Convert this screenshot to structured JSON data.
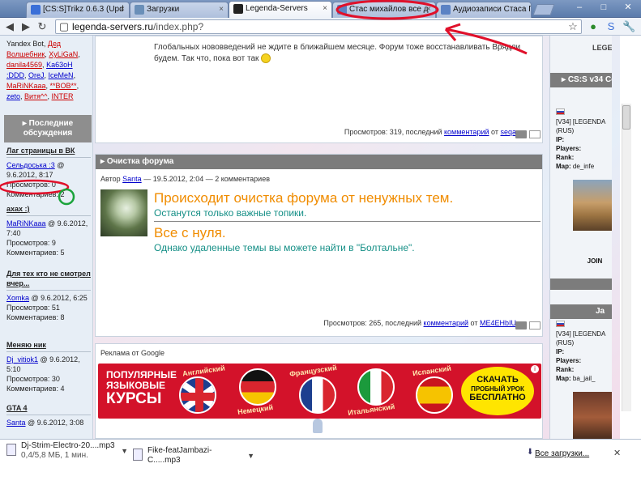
{
  "tabs": [
    {
      "label": "[CS:S]Trikz 0.6.3 (Upd",
      "color": "#3a6fd8"
    },
    {
      "label": "Загрузки",
      "color": "#6a8fb8"
    },
    {
      "label": "Legenda-Servers",
      "color": "#222222"
    },
    {
      "label": "Стас михайлов все д",
      "color": "#5b82c4"
    },
    {
      "label": "Аудиозаписи Стаса Г",
      "color": "#5b82c4"
    }
  ],
  "window_controls": {
    "minimize": "–",
    "maximize": "□",
    "close": "✕"
  },
  "omnibox": {
    "host": "legenda-servers.ru",
    "path": "/index.php?"
  },
  "sidebar": {
    "users_prefix": "Yandex Bot,",
    "users": [
      "Дед Волшебник",
      "XyLiGaN",
      "danila4569",
      "Ka63oH :DDD",
      "OreJ",
      "IceMeN",
      "MaRiNKaaa",
      "**BOB**",
      "zeto",
      "Витя^^",
      "INTER"
    ],
    "discussions_header": "Последние обсуждения",
    "discussions": [
      {
        "title": "Лаг страницы в ВК",
        "author": "Сельдоська :3",
        "date": "9.6.2012, 8:17",
        "views": "Просмотров: 0",
        "comments": "Комментариев: 2"
      },
      {
        "title": "ахах :)",
        "author": "MaRiNKaaa",
        "date": "9.6.2012, 7:40",
        "views": "Просмотров: 9",
        "comments": "Комментариев: 5"
      },
      {
        "title": "Для тех кто не смотрел вчер...",
        "author": "Xomka",
        "date": "9.6.2012, 6:25",
        "views": "Просмотров: 51",
        "comments": "Комментариев: 8"
      },
      {
        "title": "Меняю ник",
        "author": "Dj_vitiok1",
        "date": "9.6.2012, 5:10",
        "views": "Просмотров: 30",
        "comments": "Комментариев: 4"
      },
      {
        "title": "GTA 4",
        "author": "Santa",
        "date": "9.6.2012, 3:08",
        "views": "",
        "comments": ""
      }
    ]
  },
  "post_top": {
    "text": "Глобальных нововведений не ждите в ближайшем месяце. Форум тоже восстанавливать Врядли будем. Так что, пока вот так",
    "meta_prefix": "Просмотров: 319, последний",
    "meta_link": "комментарий",
    "meta_by": "от",
    "meta_user": "seqa"
  },
  "post": {
    "title": "Очистка форума",
    "byline_prefix": "Автор",
    "author": "Santa",
    "byline_rest": "— 19.5.2012, 2:04 — 2 комментариев",
    "heading1": "Происходит очистка форума от ненужных тем.",
    "sub1": "Останутся только важные топики.",
    "heading2": "Все с нуля.",
    "sub2": "Однако удаленные темы вы можете найти в \"Болтальне\".",
    "meta_prefix": "Просмотров: 265, последний",
    "meta_link": "комментарий",
    "meta_by": "от",
    "meta_user": "ME4EHbIU"
  },
  "ad": {
    "title": "Реклама от Google",
    "line1": "ПОПУЛЯРНЫЕ",
    "line2": "ЯЗЫКОВЫЕ",
    "line3": "КУРСЫ",
    "flags": [
      "Английский",
      "Немецкий",
      "Французский",
      "Итальянский",
      "Испанский"
    ],
    "cta1": "СКАЧАТЬ",
    "cta2": "ПРОБНЫЙ УРОК",
    "cta3": "БЕСПЛАТНО",
    "info": "i"
  },
  "right": {
    "top_fragment": "LEGE",
    "block1_title": "CS:S v34 Се",
    "server_name": "[V34] [LEGENDA",
    "server_region": "(RUS)",
    "ip_label": "IP:",
    "players_label": "Players:",
    "rank_label": "Rank:",
    "map_label": "Map:",
    "map1": "de_infe",
    "join": "JOIN",
    "block2_title": "Ja",
    "map2": "ba_jail_"
  },
  "downloads": [
    {
      "name": "Dj-Strim-Electro-20....mp3",
      "status": "0,4/5,8 МБ, 1 мин."
    },
    {
      "name": "Fike-featJambazi-C.....mp3",
      "status": ""
    }
  ],
  "all_downloads": "Все загрузки...",
  "shelf_close": "✕",
  "annotation_color": "#e0102a",
  "annotation_green": "#1aa33a"
}
